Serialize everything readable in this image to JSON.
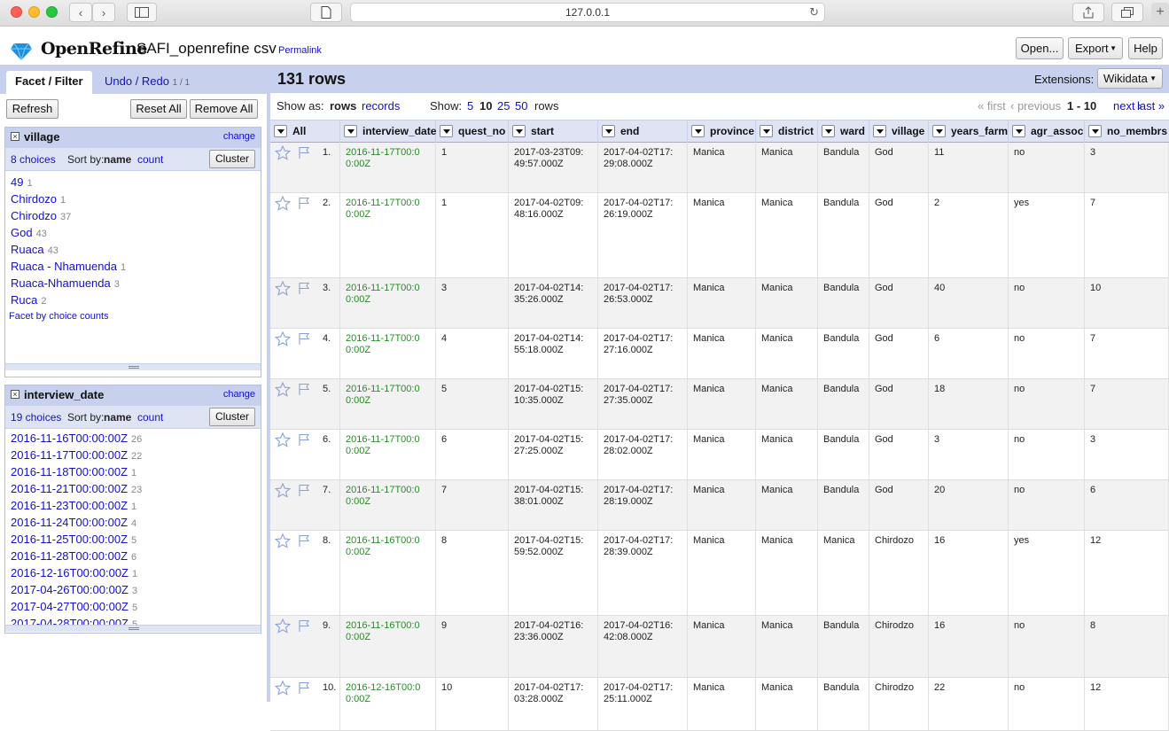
{
  "browser": {
    "url": "127.0.0.1"
  },
  "app": {
    "brand": "OpenRefine",
    "project_name": "SAFI_openrefine csv",
    "permalink": "Permalink",
    "buttons": {
      "open": "Open...",
      "export": "Export",
      "help": "Help"
    }
  },
  "left": {
    "tab_facet": "Facet / Filter",
    "tab_undo": "Undo / Redo",
    "undo_count": "1 / 1",
    "refresh": "Refresh",
    "reset_all": "Reset All",
    "remove_all": "Remove All",
    "facets": [
      {
        "title": "village",
        "change": "change",
        "choices_label": "8 choices",
        "sort_by": "Sort by:",
        "sort_name": "name",
        "sort_count": "count",
        "cluster": "Cluster",
        "items": [
          {
            "name": "49",
            "count": "1"
          },
          {
            "name": "Chirdozo",
            "count": "1"
          },
          {
            "name": "Chirodzo",
            "count": "37"
          },
          {
            "name": "God",
            "count": "43"
          },
          {
            "name": "Ruaca",
            "count": "43"
          },
          {
            "name": "Ruaca - Nhamuenda",
            "count": "1"
          },
          {
            "name": "Ruaca-Nhamuenda",
            "count": "3"
          },
          {
            "name": "Ruca",
            "count": "2"
          }
        ],
        "footer": "Facet by choice counts"
      },
      {
        "title": "interview_date",
        "change": "change",
        "choices_label": "19 choices",
        "sort_by": "Sort by:",
        "sort_name": "name",
        "sort_count": "count",
        "cluster": "Cluster",
        "items": [
          {
            "name": "2016-11-16T00:00:00Z",
            "count": "26"
          },
          {
            "name": "2016-11-17T00:00:00Z",
            "count": "22"
          },
          {
            "name": "2016-11-18T00:00:00Z",
            "count": "1"
          },
          {
            "name": "2016-11-21T00:00:00Z",
            "count": "23"
          },
          {
            "name": "2016-11-23T00:00:00Z",
            "count": "1"
          },
          {
            "name": "2016-11-24T00:00:00Z",
            "count": "4"
          },
          {
            "name": "2016-11-25T00:00:00Z",
            "count": "5"
          },
          {
            "name": "2016-11-28T00:00:00Z",
            "count": "6"
          },
          {
            "name": "2016-12-16T00:00:00Z",
            "count": "1"
          },
          {
            "name": "2017-04-26T00:00:00Z",
            "count": "3"
          },
          {
            "name": "2017-04-27T00:00:00Z",
            "count": "5"
          },
          {
            "name": "2017-04-28T00:00:00Z",
            "count": "5"
          }
        ]
      }
    ]
  },
  "main": {
    "row_count": "131 rows",
    "extensions_label": "Extensions:",
    "extensions_value": "Wikidata",
    "show_as": "Show as:",
    "mode_rows": "rows",
    "mode_records": "records",
    "show": "Show:",
    "page_sizes": [
      "5",
      "10",
      "25",
      "50"
    ],
    "page_size_current": "10",
    "rows_word": "rows",
    "first": "« first",
    "previous": "‹ previous",
    "range": "1 - 10",
    "next": "next ›",
    "last": "last »",
    "columns": [
      "All",
      "interview_date",
      "quest_no",
      "start",
      "end",
      "province",
      "district",
      "ward",
      "village",
      "years_farm",
      "agr_assoc",
      "no_membrs"
    ],
    "rows": [
      {
        "num": "1.",
        "interview_date": "2016-11-17T00:00:00Z",
        "quest_no": "1",
        "start": "2017-03-23T09:49:57.000Z",
        "end": "2017-04-02T17:29:08.000Z",
        "province": "Manica",
        "district": "Manica",
        "ward": "Bandula",
        "village": "God",
        "years_farm": "11",
        "agr_assoc": "no",
        "no_membrs": "3"
      },
      {
        "num": "2.",
        "interview_date": "2016-11-17T00:00:00Z",
        "quest_no": "1",
        "start": "2017-04-02T09:48:16.000Z",
        "end": "2017-04-02T17:26:19.000Z",
        "province": "Manica",
        "district": "Manica",
        "ward": "Bandula",
        "village": "God",
        "years_farm": "2",
        "agr_assoc": "yes",
        "no_membrs": "7"
      },
      {
        "num": "3.",
        "interview_date": "2016-11-17T00:00:00Z",
        "quest_no": "3",
        "start": "2017-04-02T14:35:26.000Z",
        "end": "2017-04-02T17:26:53.000Z",
        "province": "Manica",
        "district": "Manica",
        "ward": "Bandula",
        "village": "God",
        "years_farm": "40",
        "agr_assoc": "no",
        "no_membrs": "10"
      },
      {
        "num": "4.",
        "interview_date": "2016-11-17T00:00:00Z",
        "quest_no": "4",
        "start": "2017-04-02T14:55:18.000Z",
        "end": "2017-04-02T17:27:16.000Z",
        "province": "Manica",
        "district": "Manica",
        "ward": "Bandula",
        "village": "God",
        "years_farm": "6",
        "agr_assoc": "no",
        "no_membrs": "7"
      },
      {
        "num": "5.",
        "interview_date": "2016-11-17T00:00:00Z",
        "quest_no": "5",
        "start": "2017-04-02T15:10:35.000Z",
        "end": "2017-04-02T17:27:35.000Z",
        "province": "Manica",
        "district": "Manica",
        "ward": "Bandula",
        "village": "God",
        "years_farm": "18",
        "agr_assoc": "no",
        "no_membrs": "7"
      },
      {
        "num": "6.",
        "interview_date": "2016-11-17T00:00:00Z",
        "quest_no": "6",
        "start": "2017-04-02T15:27:25.000Z",
        "end": "2017-04-02T17:28:02.000Z",
        "province": "Manica",
        "district": "Manica",
        "ward": "Bandula",
        "village": "God",
        "years_farm": "3",
        "agr_assoc": "no",
        "no_membrs": "3"
      },
      {
        "num": "7.",
        "interview_date": "2016-11-17T00:00:00Z",
        "quest_no": "7",
        "start": "2017-04-02T15:38:01.000Z",
        "end": "2017-04-02T17:28:19.000Z",
        "province": "Manica",
        "district": "Manica",
        "ward": "Bandula",
        "village": "God",
        "years_farm": "20",
        "agr_assoc": "no",
        "no_membrs": "6"
      },
      {
        "num": "8.",
        "interview_date": "2016-11-16T00:00:00Z",
        "quest_no": "8",
        "start": "2017-04-02T15:59:52.000Z",
        "end": "2017-04-02T17:28:39.000Z",
        "province": "Manica",
        "district": "Manica",
        "ward": "Manica",
        "village": "Chirdozo",
        "years_farm": "16",
        "agr_assoc": "yes",
        "no_membrs": "12"
      },
      {
        "num": "9.",
        "interview_date": "2016-11-16T00:00:00Z",
        "quest_no": "9",
        "start": "2017-04-02T16:23:36.000Z",
        "end": "2017-04-02T16:42:08.000Z",
        "province": "Manica",
        "district": "Manica",
        "ward": "Bandula",
        "village": "Chirodzo",
        "years_farm": "16",
        "agr_assoc": "no",
        "no_membrs": "8"
      },
      {
        "num": "10.",
        "interview_date": "2016-12-16T00:00:00Z",
        "quest_no": "10",
        "start": "2017-04-02T17:03:28.000Z",
        "end": "2017-04-02T17:25:11.000Z",
        "province": "Manica",
        "district": "Manica",
        "ward": "Bandula",
        "village": "Chirodzo",
        "years_farm": "22",
        "agr_assoc": "no",
        "no_membrs": "12"
      }
    ]
  }
}
